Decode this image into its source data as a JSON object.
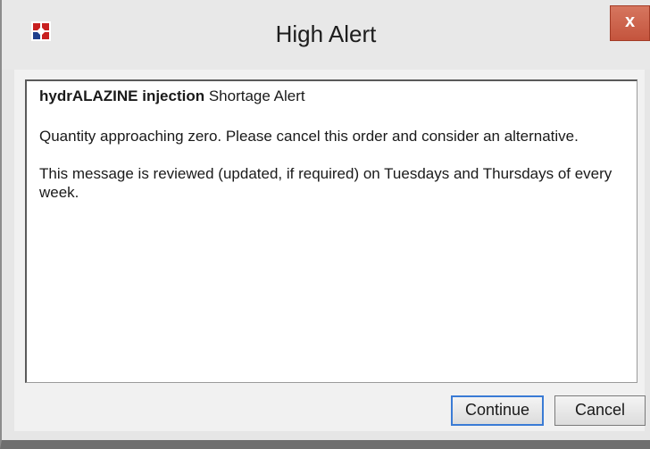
{
  "window": {
    "title": "High Alert",
    "close_label": "x",
    "app_icon": "app-logo-icon"
  },
  "message": {
    "drug_name": "hydrALAZINE injection",
    "alert_type": " Shortage Alert",
    "line1": "Quantity approaching zero. Please cancel this order and consider an alternative.",
    "line2": "This message is reviewed (updated, if required) on Tuesdays and Thursdays of every week."
  },
  "buttons": {
    "continue_label": "Continue",
    "cancel_label": "Cancel"
  },
  "colors": {
    "close_button": "#c4543d",
    "focus_border": "#3a7bd5"
  }
}
